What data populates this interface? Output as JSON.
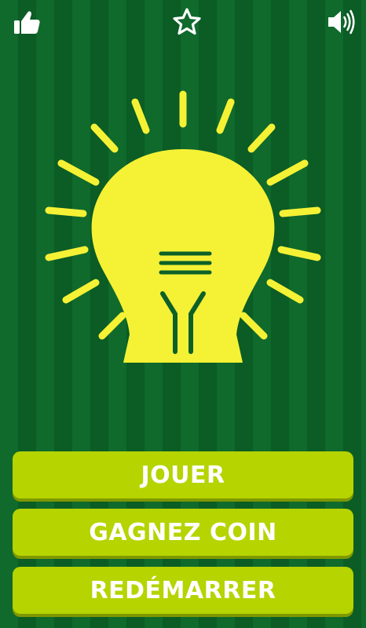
{
  "top_bar": {
    "icons": {
      "like": "thumbs-up-icon",
      "favorite": "star-icon",
      "sound": "speaker-on-icon"
    }
  },
  "menu": {
    "play_label": "JOUER",
    "earn_coins_label": "GAGNEZ COIN",
    "restart_label": "REDÉMARRER"
  },
  "colors": {
    "background": "#0d6128",
    "bulb": "#f5f135",
    "button": "#b5d400",
    "button_text": "#ffffff",
    "icon": "#ffffff"
  }
}
